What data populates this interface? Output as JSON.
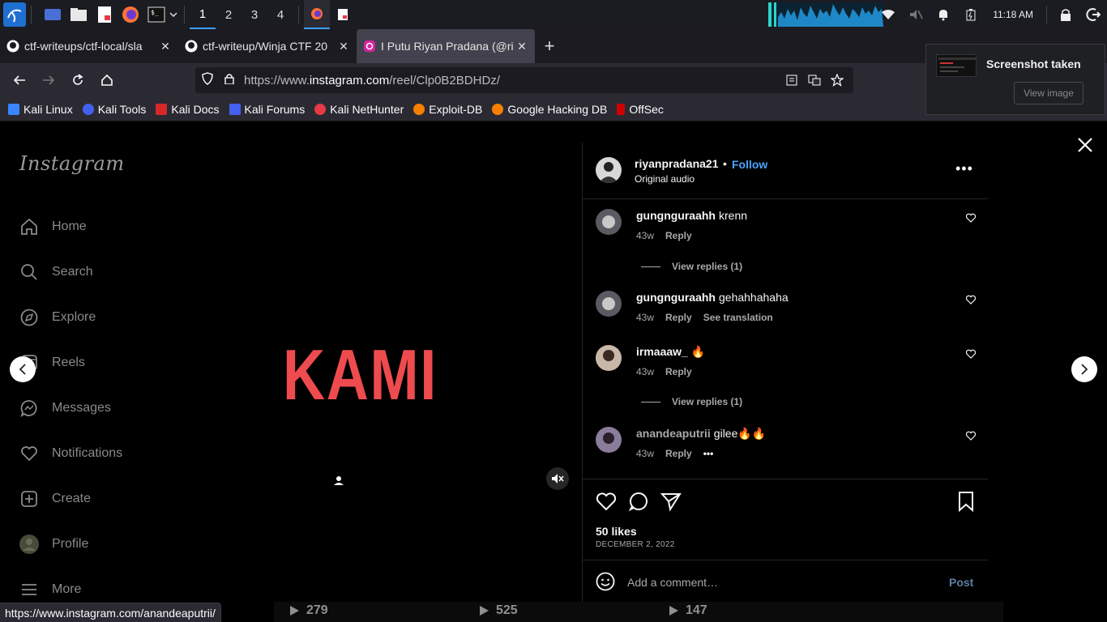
{
  "taskbar": {
    "workspaces": [
      "1",
      "2",
      "3",
      "4"
    ],
    "active_workspace": "1",
    "clock": "11:18 AM"
  },
  "browser": {
    "tabs": [
      {
        "title": "ctf-writeups/ctf-local/sla",
        "icon": "github-icon",
        "active": false
      },
      {
        "title": "ctf-writeup/Winja CTF 20",
        "icon": "github-icon",
        "active": false
      },
      {
        "title": "I Putu Riyan Pradana (@ri",
        "icon": "instagram-icon",
        "active": true
      }
    ],
    "new_tab_label": "+",
    "url_prefix": "https://www.",
    "url_domain": "instagram.com",
    "url_path": "/reel/Clp0B2BDHDz/",
    "bookmarks": [
      {
        "label": "Kali Linux",
        "color": "#3a86ff"
      },
      {
        "label": "Kali Tools",
        "color": "#e63946"
      },
      {
        "label": "Kali Docs",
        "color": "#d62828"
      },
      {
        "label": "Kali Forums",
        "color": "#4361ee"
      },
      {
        "label": "Kali NetHunter",
        "color": "#e63946"
      },
      {
        "label": "Exploit-DB",
        "color": "#f77f00"
      },
      {
        "label": "Google Hacking DB",
        "color": "#f77f00"
      },
      {
        "label": "OffSec",
        "color": "#d00000"
      }
    ],
    "status_url": "https://www.instagram.com/anandeaputrii/"
  },
  "notification": {
    "title": "Screenshot taken",
    "button": "View image"
  },
  "instagram": {
    "logo": "Instagram",
    "nav": [
      "Home",
      "Search",
      "Explore",
      "Reels",
      "Messages",
      "Notifications",
      "Create",
      "Profile",
      "More"
    ],
    "reel_text": "KAMI",
    "post": {
      "username": "riyanpradana21",
      "dot": "•",
      "follow": "Follow",
      "audio": "Original audio",
      "more": "•••",
      "likes": "50 likes",
      "date": "DECEMBER 2, 2022"
    },
    "comments": [
      {
        "user": "gungnguraahh",
        "text": "krenn",
        "time": "43w",
        "reply": "Reply",
        "extra": "",
        "view_replies": "View replies (1)"
      },
      {
        "user": "gungnguraahh",
        "text": "gehahhahaha",
        "time": "43w",
        "reply": "Reply",
        "extra": "See translation",
        "view_replies": ""
      },
      {
        "user": "irmaaaw_",
        "text": "🔥",
        "time": "43w",
        "reply": "Reply",
        "extra": "",
        "view_replies": "View replies (1)"
      },
      {
        "user": "anandeaputrii",
        "text": "gilee🔥🔥",
        "time": "43w",
        "reply": "Reply",
        "extra": "•••",
        "view_replies": ""
      }
    ],
    "comment_placeholder": "Add a comment…",
    "post_button": "Post",
    "grid_stats": [
      "279",
      "525",
      "147"
    ]
  }
}
